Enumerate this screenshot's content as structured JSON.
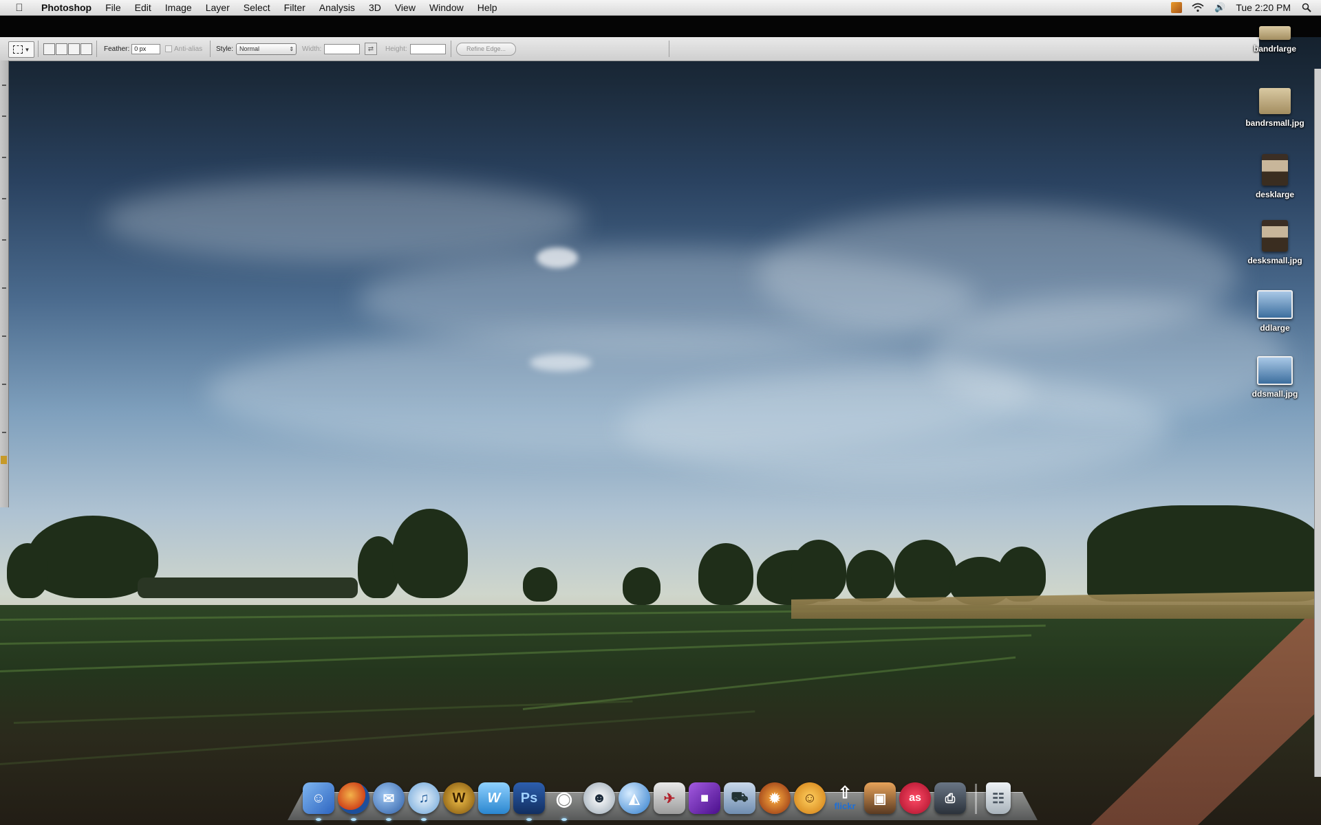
{
  "menubar": {
    "apple_icon": "apple-icon",
    "app_name": "Photoshop",
    "menus": [
      "File",
      "Edit",
      "Image",
      "Layer",
      "Select",
      "Filter",
      "Analysis",
      "3D",
      "View",
      "Window",
      "Help"
    ],
    "status": {
      "icons": [
        "app-status-icon",
        "wifi-icon",
        "volume-icon",
        "spotlight-icon"
      ],
      "clock": "Tue 2:20 PM"
    }
  },
  "options_bar": {
    "tool": "rectangular-marquee",
    "feather_label": "Feather:",
    "feather_value": "0 px",
    "anti_alias_label": "Anti-alias",
    "style_label": "Style:",
    "style_value": "Normal",
    "width_label": "Width:",
    "width_value": "",
    "height_label": "Height:",
    "height_value": "",
    "refine_edge_label": "Refine Edge..."
  },
  "desktop_icons": [
    {
      "label": "bandrlarge",
      "thumb": "beige"
    },
    {
      "label": "bandrsmall.jpg",
      "thumb": "beige"
    },
    {
      "label": "desklarge",
      "thumb": "desk"
    },
    {
      "label": "desksmall.jpg",
      "thumb": "desk"
    },
    {
      "label": "ddlarge",
      "thumb": "blue"
    },
    {
      "label": "ddsmall.jpg",
      "thumb": "blue"
    }
  ],
  "dock": {
    "items": [
      {
        "name": "finder",
        "color": "#3d7bd6",
        "glyph": "☺"
      },
      {
        "name": "firefox",
        "color": "#e0661b",
        "glyph": "◉"
      },
      {
        "name": "thunderbird",
        "color": "#3c6db0",
        "glyph": "✉"
      },
      {
        "name": "itunes",
        "color": "#5a9ad6",
        "glyph": "♫"
      },
      {
        "name": "world-of-warcraft",
        "color": "#b07a12",
        "glyph": "W"
      },
      {
        "name": "wordpress-editor",
        "color": "#2f8fd0",
        "glyph": "W"
      },
      {
        "name": "photoshop",
        "color": "#1d4b8f",
        "glyph": "Ps"
      },
      {
        "name": "adium",
        "color": "#2a2a2a",
        "glyph": "◐"
      },
      {
        "name": "skype-chat",
        "color": "#dfe5ea",
        "glyph": "☻"
      },
      {
        "name": "network-globe",
        "color": "#3a8ad0",
        "glyph": "◍"
      },
      {
        "name": "installer",
        "color": "#b8b8b8",
        "glyph": "✈"
      },
      {
        "name": "purple-app",
        "color": "#6d1fb8",
        "glyph": "■"
      },
      {
        "name": "transmit",
        "color": "#8ba7c8",
        "glyph": "⛟"
      },
      {
        "name": "burn",
        "color": "#d55a1c",
        "glyph": "✹"
      },
      {
        "name": "cyberduck",
        "color": "#f0a01a",
        "glyph": "☺"
      },
      {
        "name": "flickr-uploadr",
        "color": "#e9eef5",
        "glyph": "⇧"
      },
      {
        "name": "image-capture",
        "color": "#7a4a2a",
        "glyph": "▣"
      },
      {
        "name": "lastfm",
        "color": "#d01f3c",
        "glyph": "as"
      },
      {
        "name": "printer",
        "color": "#4a5563",
        "glyph": "⎙"
      },
      {
        "name": "trash",
        "color": "#c9d0d6",
        "glyph": "🗑"
      }
    ]
  }
}
